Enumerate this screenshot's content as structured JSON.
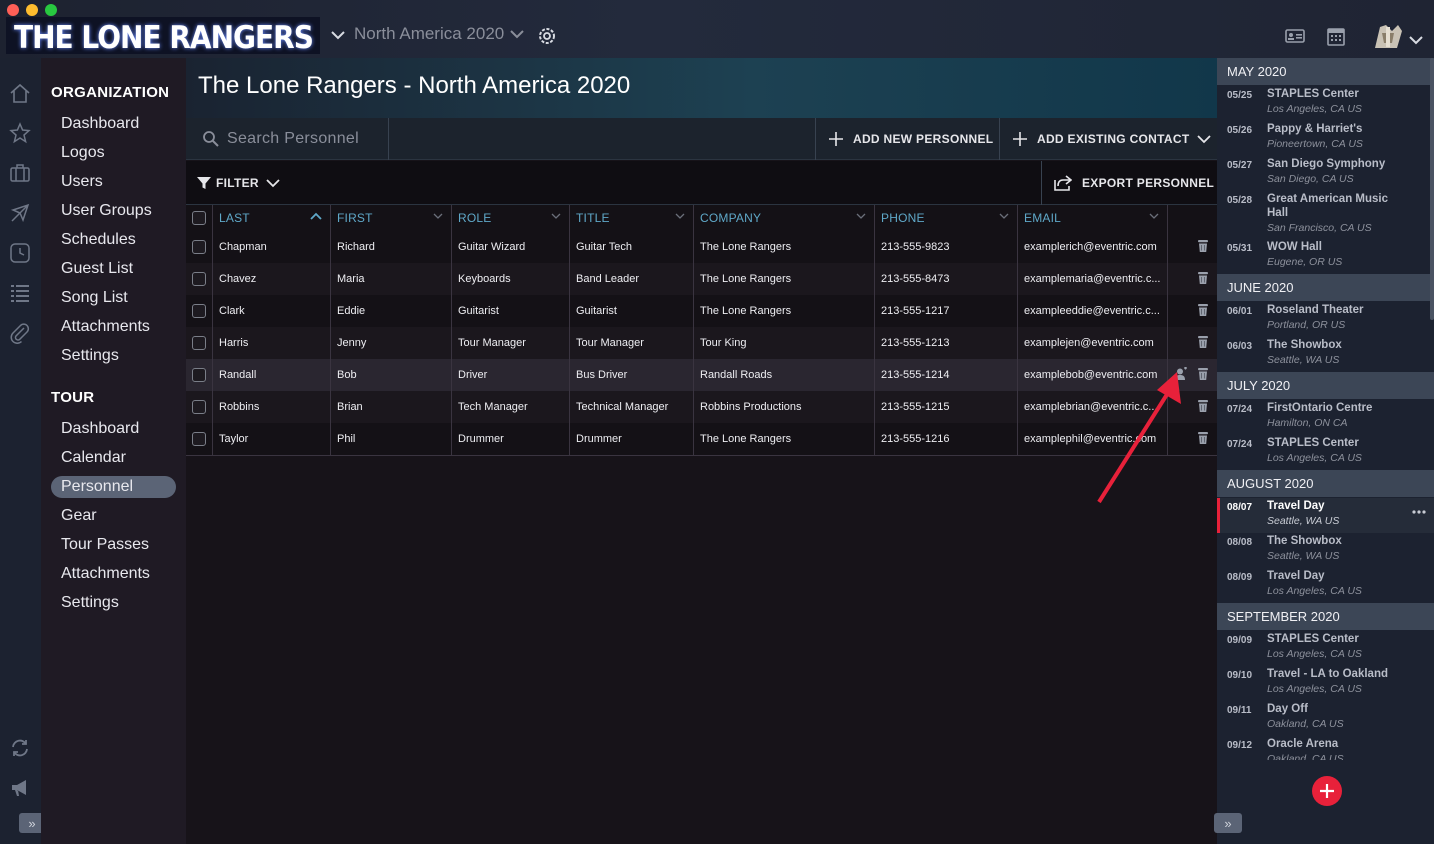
{
  "app": {
    "logo_text": "THE LONE RANGERS",
    "tour_selector": "North America 2020"
  },
  "sidebar": {
    "org_heading": "ORGANIZATION",
    "org_items": [
      "Dashboard",
      "Logos",
      "Users",
      "User Groups",
      "Schedules",
      "Guest List",
      "Song List",
      "Attachments",
      "Settings"
    ],
    "tour_heading": "TOUR",
    "tour_items": [
      "Dashboard",
      "Calendar",
      "Personnel",
      "Gear",
      "Tour Passes",
      "Attachments",
      "Settings"
    ],
    "active_item": "Personnel"
  },
  "main": {
    "title": "The Lone Rangers - North America 2020",
    "search_placeholder": "Search Personnel",
    "add_new_label": "ADD NEW PERSONNEL",
    "add_existing_label": "ADD EXISTING CONTACT",
    "filter_label": "FILTER",
    "export_label": "EXPORT PERSONNEL"
  },
  "table": {
    "columns": [
      "LAST",
      "FIRST",
      "ROLE",
      "TITLE",
      "COMPANY",
      "PHONE",
      "EMAIL"
    ],
    "rows": [
      [
        "Chapman",
        "Richard",
        "Guitar Wizard",
        "Guitar Tech",
        "The Lone Rangers",
        "213-555-9823",
        "examplerich@eventric.com"
      ],
      [
        "Chavez",
        "Maria",
        "Keyboards",
        "Band Leader",
        "The Lone Rangers",
        "213-555-8473",
        "examplemaria@eventric.c..."
      ],
      [
        "Clark",
        "Eddie",
        "Guitarist",
        "Guitarist",
        "The Lone Rangers",
        "213-555-1217",
        "exampleeddie@eventric.c..."
      ],
      [
        "Harris",
        "Jenny",
        "Tour Manager",
        "Tour Manager",
        "Tour King",
        "213-555-1213",
        "examplejen@eventric.com"
      ],
      [
        "Randall",
        "Bob",
        "Driver",
        "Bus Driver",
        "Randall Roads",
        "213-555-1214",
        "examplebob@eventric.com"
      ],
      [
        "Robbins",
        "Brian",
        "Tech Manager",
        "Technical Manager",
        "Robbins Productions",
        "213-555-1215",
        "examplebrian@eventric.c..."
      ],
      [
        "Taylor",
        "Phil",
        "Drummer",
        "Drummer",
        "The Lone Rangers",
        "213-555-1216",
        "examplephil@eventric.com"
      ]
    ],
    "hovered_row": 4
  },
  "schedule": {
    "months": [
      {
        "name": "MAY 2020",
        "events": [
          {
            "date": "05/25",
            "venue": "STAPLES Center",
            "location": "Los Angeles, CA US"
          },
          {
            "date": "05/26",
            "venue": "Pappy & Harriet's",
            "location": "Pioneertown, CA US"
          },
          {
            "date": "05/27",
            "venue": "San Diego Symphony",
            "location": "San Diego, CA US"
          },
          {
            "date": "05/28",
            "venue": "Great American Music",
            "venue2": "Hall",
            "location": "San Francisco, CA US"
          },
          {
            "date": "05/31",
            "venue": "WOW Hall",
            "location": "Eugene, OR US"
          }
        ]
      },
      {
        "name": "JUNE 2020",
        "events": [
          {
            "date": "06/01",
            "venue": "Roseland Theater",
            "location": "Portland, OR US"
          },
          {
            "date": "06/03",
            "venue": "The Showbox",
            "location": "Seattle, WA US"
          }
        ]
      },
      {
        "name": "JULY 2020",
        "events": [
          {
            "date": "07/24",
            "venue": "FirstOntario Centre",
            "location": "Hamilton, ON CA"
          },
          {
            "date": "07/24",
            "venue": "STAPLES Center",
            "location": "Los Angeles, CA US"
          }
        ]
      },
      {
        "name": "AUGUST 2020",
        "events": [
          {
            "date": "08/07",
            "venue": "Travel Day",
            "location": "Seattle, WA US",
            "highlight": true
          },
          {
            "date": "08/08",
            "venue": "The Showbox",
            "location": "Seattle, WA US"
          },
          {
            "date": "08/09",
            "venue": "Travel Day",
            "location": "Los Angeles, CA US"
          }
        ]
      },
      {
        "name": "SEPTEMBER 2020",
        "events": [
          {
            "date": "09/09",
            "venue": "STAPLES Center",
            "location": "Los Angeles, CA US"
          },
          {
            "date": "09/10",
            "venue": "Travel - LA to Oakland",
            "location": "Los Angeles, CA US"
          },
          {
            "date": "09/11",
            "venue": "Day Off",
            "location": "Oakland, CA US"
          },
          {
            "date": "09/12",
            "venue": "Oracle Arena",
            "location": "Oakland, CA US"
          }
        ]
      }
    ]
  },
  "colors": {
    "accent_blue": "#5fa8c8",
    "fab_red": "#e8213a",
    "arrow_red": "#e8213a",
    "active_nav": "#5b6476"
  },
  "icons": {
    "rail": [
      "home-icon",
      "star-icon",
      "briefcase-icon",
      "plane-icon",
      "clock-icon",
      "list-icon",
      "paperclip-icon"
    ],
    "rail_bottom": [
      "sync-icon",
      "megaphone-icon"
    ],
    "topright": [
      "contact-card-icon",
      "calendar-icon",
      "avatar"
    ]
  }
}
